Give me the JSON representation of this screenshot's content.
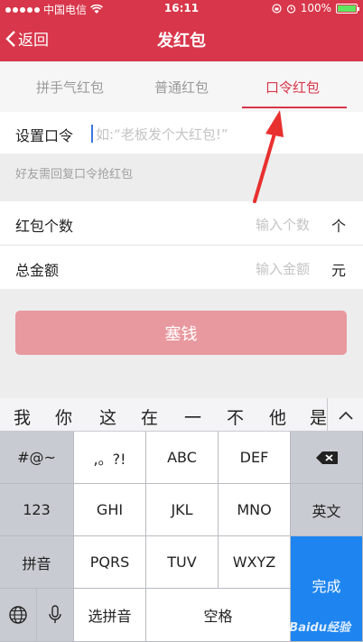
{
  "status_bar": {
    "carrier": "中国电信",
    "time": "16:11",
    "battery": "100%",
    "battery_level": 1.0
  },
  "nav": {
    "back_label": "返回",
    "title": "发红包"
  },
  "tabs": [
    {
      "label": "拼手气红包",
      "active": false
    },
    {
      "label": "普通红包",
      "active": false
    },
    {
      "label": "口令红包",
      "active": true
    }
  ],
  "form": {
    "password_label": "设置口令",
    "password_placeholder": "如:“老板发个大红包!”",
    "hint": "好友需回复口令抢红包",
    "count_label": "红包个数",
    "count_placeholder": "输入个数",
    "count_unit": "个",
    "amount_label": "总金额",
    "amount_placeholder": "输入金额",
    "amount_unit": "元",
    "submit_label": "塞钱"
  },
  "keyboard": {
    "candidates": [
      "我",
      "你",
      "这",
      "在",
      "一",
      "不",
      "他",
      "是"
    ],
    "keys": {
      "symbols": "#@~",
      "punct": ",。?!",
      "abc": "ABC",
      "def": "DEF",
      "num": "123",
      "ghi": "GHI",
      "jkl": "JKL",
      "mno": "MNO",
      "english": "英文",
      "pinyin": "拼音",
      "pqrs": "PQRS",
      "tuv": "TUV",
      "wxyz": "WXYZ",
      "select_pinyin": "选拼音",
      "space": "空格",
      "done": "完成"
    }
  },
  "watermark": "Baidu经验",
  "colors": {
    "brand_red": "#d8364a",
    "submit_disabled": "#e8999f",
    "keyboard_blue": "#1e85f0"
  },
  "icons": [
    "chevron-left-icon",
    "wifi-icon",
    "lock-rotation-icon",
    "alarm-icon",
    "battery-icon",
    "backspace-icon",
    "chevron-up-icon",
    "globe-icon",
    "microphone-icon"
  ]
}
